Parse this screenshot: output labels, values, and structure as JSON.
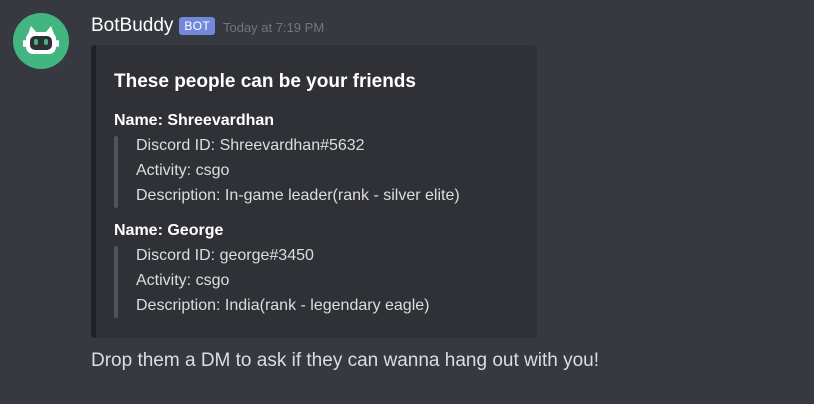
{
  "message": {
    "author": {
      "name": "BotBuddy",
      "tag": "BOT",
      "avatar_icon": "robot-icon",
      "avatar_color": "#43b581"
    },
    "timestamp": "Today at 7:19 PM",
    "embed": {
      "title": "These people can be your friends",
      "fields": [
        {
          "name": "Name: Shreevardhan",
          "lines": [
            "Discord ID: Shreevardhan#5632",
            "Activity: csgo",
            "Description: In-game leader(rank - silver elite)"
          ]
        },
        {
          "name": "Name: George",
          "lines": [
            "Discord ID: george#3450",
            "Activity: csgo",
            "Description: India(rank - legendary eagle)"
          ]
        }
      ]
    },
    "followup_text": "Drop them a DM to ask if they can wanna hang out with you!"
  },
  "colors": {
    "background": "#36393f",
    "embed_background": "#2f3136",
    "bot_tag": "#7289da",
    "timestamp": "#72767d"
  }
}
